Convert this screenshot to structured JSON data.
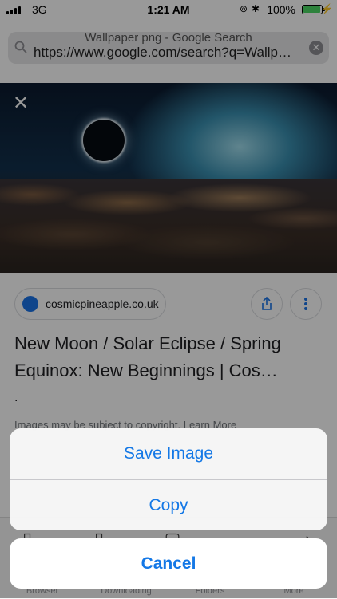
{
  "status_bar": {
    "carrier": "3G",
    "time": "1:21 AM",
    "battery": "100%"
  },
  "url_bar": {
    "title": "Wallpaper png - Google Search",
    "url": "https://www.google.com/search?q=Wallp…"
  },
  "result": {
    "domain": "cosmicpineapple.co.uk",
    "title": "New Moon / Solar Eclipse / Spring Equinox: New Beginnings | Cos…",
    "snippet": ".",
    "disclaimer": "Images may be subject to copyright. Learn More"
  },
  "bottom_bar": {
    "items": [
      {
        "label": "Browser"
      },
      {
        "label": "Downloading"
      },
      {
        "label": "Folders"
      },
      {
        "label": "More"
      }
    ]
  },
  "action_sheet": {
    "save_label": "Save Image",
    "copy_label": "Copy",
    "cancel_label": "Cancel"
  },
  "colors": {
    "accent": "#1478e6",
    "battery": "#4cd964"
  },
  "icons": [
    "search-icon",
    "clear-icon",
    "close-icon",
    "globe-icon",
    "share-icon",
    "more-icon"
  ]
}
